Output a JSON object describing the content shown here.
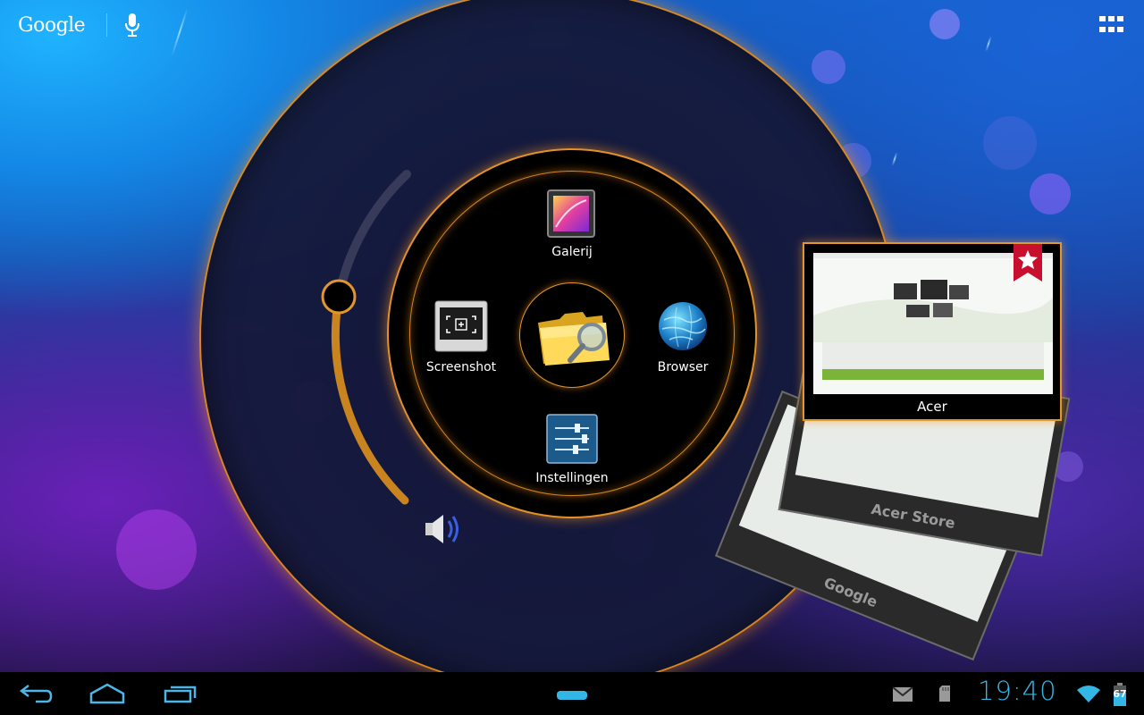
{
  "search": {
    "label": "Google"
  },
  "launcher": {
    "items": [
      {
        "label": "Galerij",
        "icon": "gallery-icon"
      },
      {
        "label": "Screenshot",
        "icon": "screenshot-icon"
      },
      {
        "label": "Browser",
        "icon": "globe-icon"
      },
      {
        "label": "Instellingen",
        "icon": "settings-sliders-icon"
      }
    ],
    "center_icon": "folder-search-icon",
    "volume_icon": "speaker-icon"
  },
  "recent_apps": [
    {
      "label": "Acer",
      "bookmarked": true
    },
    {
      "label": "Acer Store"
    },
    {
      "label": "Google"
    }
  ],
  "status": {
    "time": "19:40",
    "battery": "67",
    "icons": [
      "gmail-icon",
      "sd-card-icon",
      "wifi-icon",
      "battery-icon"
    ]
  },
  "nav": {
    "icons": [
      "back-icon",
      "home-icon",
      "recent-apps-icon",
      "menu-handle-icon"
    ]
  },
  "colors": {
    "accent_orange": "#e2962c",
    "clock_blue": "#37b6e6"
  }
}
